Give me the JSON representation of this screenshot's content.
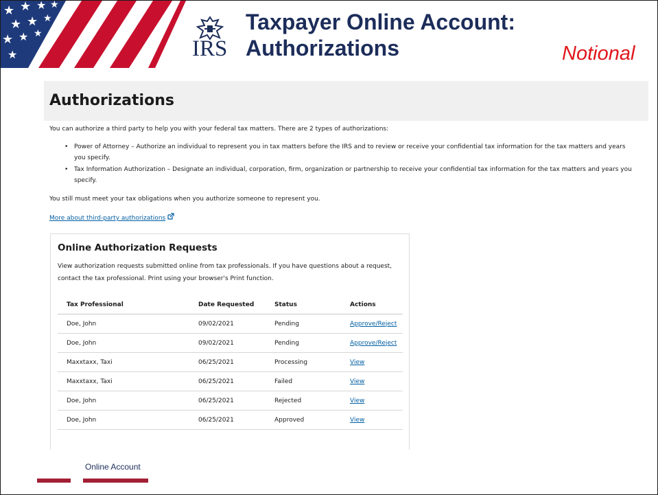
{
  "slide": {
    "title_line1": "Taxpayer Online Account:",
    "title_line2": "Authorizations",
    "tag": "Notional",
    "logo_text": "IRS",
    "footer_label": "Online Account",
    "colors": {
      "navy": "#1c2d5a",
      "red_tag": "#e0161c",
      "footer_bar": "#a31f34",
      "flag_red": "#c8102e",
      "flag_blue": "#1e3a7b"
    }
  },
  "page": {
    "heading": "Authorizations",
    "intro": "You can authorize a third party to help you with your federal tax matters. There are 2 types of authorizations:",
    "bullets": [
      "Power of Attorney – Authorize an individual to represent you in tax matters before the IRS and to review or receive your confidential tax information for the tax matters and years you specify.",
      "Tax Information Authorization – Designate an individual, corporation, firm, organization or partnership to receive your confidential tax information for the tax matters and years you specify."
    ],
    "obligations": "You still must meet your tax obligations when you authorize someone to represent you.",
    "more_link": "More about third-party authorizations",
    "more_link_icon": "external-link-icon"
  },
  "requests": {
    "title": "Online Authorization Requests",
    "description": "View authorization requests submitted online from tax professionals. If you have questions about a request, contact the tax professional. Print using your browser's Print function.",
    "columns": [
      "Tax Professional",
      "Date Requested",
      "Status",
      "Actions"
    ],
    "rows": [
      {
        "professional": "Doe, John",
        "date": "09/02/2021",
        "status": "Pending",
        "action": "Approve/Reject"
      },
      {
        "professional": "Doe, John",
        "date": "09/02/2021",
        "status": "Pending",
        "action": "Approve/Reject"
      },
      {
        "professional": "Maxxtaxx, Taxi",
        "date": "06/25/2021",
        "status": "Processing",
        "action": "View"
      },
      {
        "professional": "Maxxtaxx, Taxi",
        "date": "06/25/2021",
        "status": "Failed",
        "action": "View"
      },
      {
        "professional": "Doe, John",
        "date": "06/25/2021",
        "status": "Rejected",
        "action": "View"
      },
      {
        "professional": "Doe, John",
        "date": "06/25/2021",
        "status": "Approved",
        "action": "View"
      }
    ]
  }
}
